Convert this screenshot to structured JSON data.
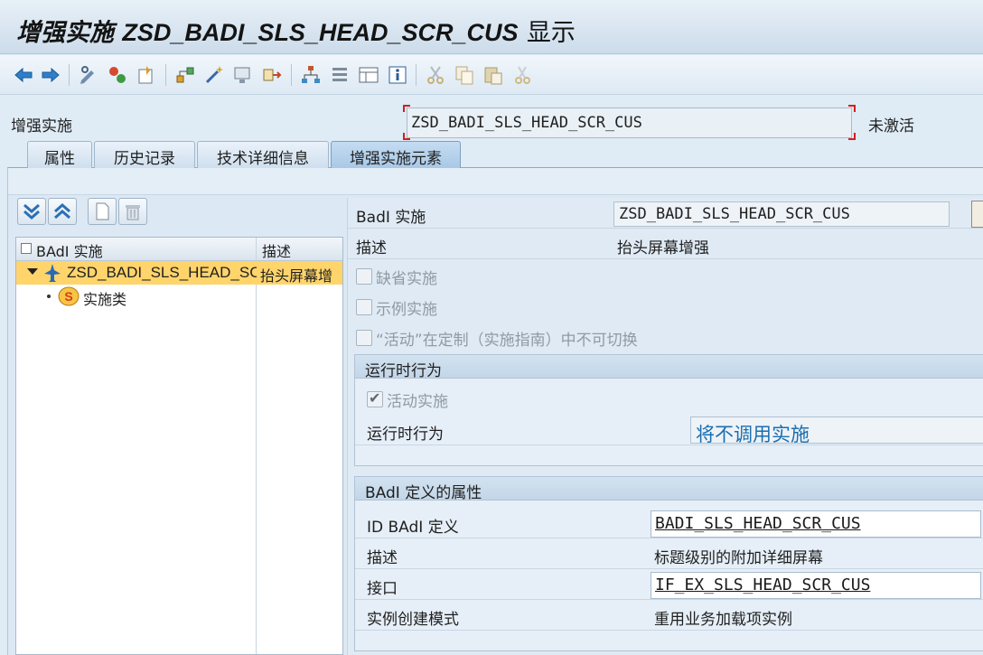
{
  "window": {
    "title_prefix": "增强实施",
    "title_object": "ZSD_BADI_SLS_HEAD_SCR_CUS",
    "title_suffix": "显示"
  },
  "header": {
    "label": "增强实施",
    "value": "ZSD_BADI_SLS_HEAD_SCR_CUS",
    "status": "未激活"
  },
  "tabs": [
    {
      "label": "属性"
    },
    {
      "label": "历史记录"
    },
    {
      "label": "技术详细信息"
    },
    {
      "label": "增强实施元素",
      "active": true
    }
  ],
  "tree": {
    "columns": [
      "BAdI 实施",
      "描述"
    ],
    "rows": [
      {
        "name": "ZSD_BADI_SLS_HEAD_SC",
        "desc": "抬头屏幕增",
        "selected": true
      },
      {
        "name": "实施类",
        "desc": ""
      }
    ]
  },
  "details": {
    "badi_impl_label": "BadI 实施",
    "badi_impl_value": "ZSD_BADI_SLS_HEAD_SCR_CUS",
    "desc_label": "描述",
    "desc_value": "抬头屏幕增强",
    "checkboxes": [
      {
        "label": "缺省实施",
        "checked": false
      },
      {
        "label": "示例实施",
        "checked": false
      },
      {
        "label": "“活动”在定制（实施指南）中不可切换",
        "checked": false
      }
    ],
    "runtime_group": {
      "title": "运行时行为",
      "active_label": "活动实施",
      "active_checked": true,
      "behavior_label": "运行时行为",
      "behavior_value": "将不调用实施"
    },
    "def_group": {
      "title": "BAdI 定义的属性",
      "rows": [
        {
          "label": "ID BAdI 定义",
          "value": "BADI_SLS_HEAD_SCR_CUS",
          "boxed": true
        },
        {
          "label": "描述",
          "value": "标题级别的附加详细屏幕",
          "boxed": false
        },
        {
          "label": "接口",
          "value": "IF_EX_SLS_HEAD_SCR_CUS",
          "boxed": true
        },
        {
          "label": "实例创建模式",
          "value": "重用业务加载项实例",
          "boxed": false
        }
      ]
    }
  },
  "colors": {
    "selection": "#ffd46b",
    "runtime_value": "#1a6fb0",
    "required_bracket": "#d02020"
  }
}
